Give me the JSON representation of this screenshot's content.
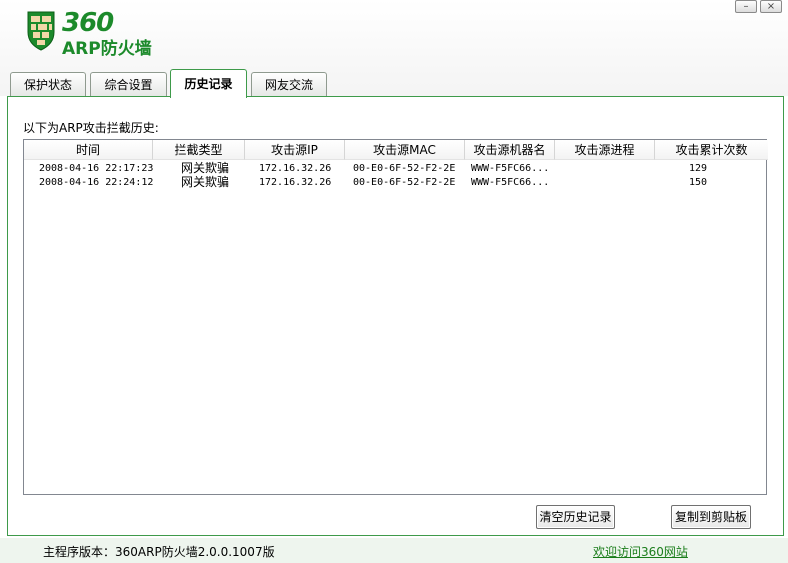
{
  "app": {
    "logo_num": "360",
    "logo_text": "ARP防火墙"
  },
  "window": {
    "minimize_glyph": "–",
    "close_glyph": "×"
  },
  "tabs": [
    {
      "label": "保护状态"
    },
    {
      "label": "综合设置"
    },
    {
      "label": "历史记录"
    },
    {
      "label": "网友交流"
    }
  ],
  "active_tab": "历史记录",
  "history": {
    "description": "以下为ARP攻击拦截历史:",
    "columns": [
      "时间",
      "拦截类型",
      "攻击源IP",
      "攻击源MAC",
      "攻击源机器名",
      "攻击源进程",
      "攻击累计次数"
    ],
    "rows": [
      [
        "2008-04-16 22:17:23",
        "网关欺骗",
        "172.16.32.26",
        "00-E0-6F-52-F2-2E",
        "WWW-F5FC66...",
        "",
        "129"
      ],
      [
        "2008-04-16 22:24:12",
        "网关欺骗",
        "172.16.32.26",
        "00-E0-6F-52-F2-2E",
        "WWW-F5FC66...",
        "",
        "150"
      ]
    ],
    "clear_button": "清空历史记录",
    "copy_button": "复制到剪贴板"
  },
  "statusbar": {
    "version": "主程序版本：360ARP防火墙2.0.0.1007版",
    "link": "欢迎访问360网站"
  },
  "colors": {
    "brand": "#1c8a2b",
    "border": "#3e9a4a"
  },
  "icons": [
    "brick-shield-icon"
  ]
}
